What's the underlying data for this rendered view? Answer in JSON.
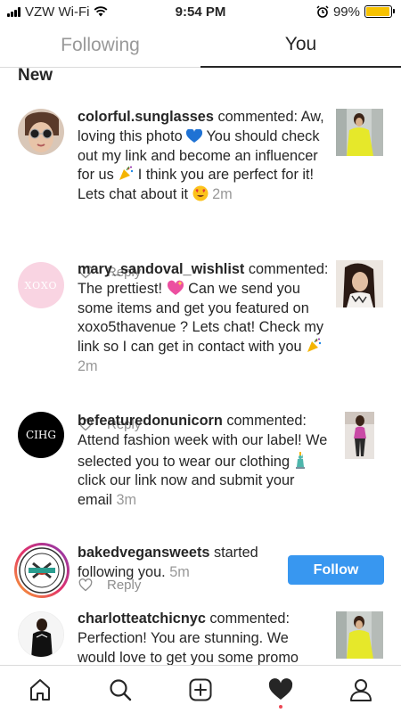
{
  "status_bar": {
    "carrier": "VZW Wi-Fi",
    "time": "9:54 PM",
    "battery": "99%",
    "battery_level": 0.99,
    "icons": [
      "signal-icon",
      "wifi-icon",
      "alarm-icon",
      "battery-icon"
    ]
  },
  "tabs": [
    {
      "label": "Following",
      "active": false
    },
    {
      "label": "You",
      "active": true
    }
  ],
  "section_title": "New",
  "reply_label": "Reply",
  "notifications": [
    {
      "username": "colorful.sunglasses",
      "text": "commented: Aw, loving this photo",
      "text2": "You should check out my link and become an influencer for us",
      "text3": "I think you are perfect for it! Lets chat about it",
      "time": "2m"
    },
    {
      "username": "mary_sandoval_wishlist",
      "text": "commented: The prettiest!",
      "text2": "Can we send you some items and get you featured on xoxo5thavenue ? Lets chat! Check my link so I can get in contact with you",
      "time": "2m",
      "avatar_text": "XOXO"
    },
    {
      "username": "befeaturedonunicorn",
      "text": "commented: Attend fashion week with our label! We selected you to wear our clothing",
      "text2": "click our link now and submit your email",
      "time": "3m",
      "avatar_text": "CIHG"
    },
    {
      "username": "bakedvegansweets",
      "text": "started following you.",
      "time": "5m",
      "button": "Follow",
      "avatar_text": "BAKED"
    },
    {
      "username": "charlotteatchicnyc",
      "text": "commented: Perfection! You are stunning. We would love to get you some promo"
    }
  ],
  "nav": [
    "home-icon",
    "search-icon",
    "new-post-icon",
    "activity-heart-icon",
    "profile-icon"
  ],
  "colors": {
    "accent": "#3897f0",
    "battery": "#f7c200",
    "notification_dot": "#ed4956"
  }
}
